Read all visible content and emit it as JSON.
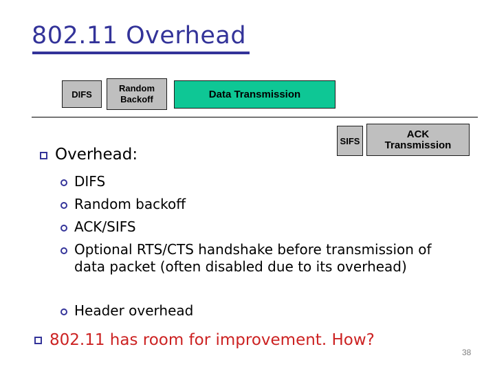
{
  "slide": {
    "title": "802.11 Overhead",
    "title_color": "#333399",
    "page_number": "38",
    "background": "#ffffff"
  },
  "timeline_diagram": {
    "name": "802.11 frame exchange timeline",
    "rule_color": "#000000",
    "boxes": [
      {
        "id": "difs",
        "label": "DIFS",
        "row": 1,
        "fill": "#bfbfbf",
        "text_color": "#000000"
      },
      {
        "id": "backoff",
        "line1": "Random",
        "line2": "Backoff",
        "row": 1,
        "fill": "#bfbfbf",
        "text_color": "#000000"
      },
      {
        "id": "data",
        "label": "Data Transmission",
        "row": 1,
        "fill": "#0ec795",
        "text_color": "#000000"
      },
      {
        "id": "sifs",
        "label": "SIFS",
        "row": 2,
        "fill": "#bfbfbf",
        "text_color": "#000000"
      },
      {
        "id": "ack",
        "line1": "ACK",
        "line2": "Transmission",
        "row": 2,
        "fill": "#bfbfbf",
        "text_color": "#000000"
      }
    ]
  },
  "body": {
    "overhead_heading": "Overhead:",
    "overhead_items": [
      "DIFS",
      "Random backoff",
      "ACK/SIFS",
      "Optional RTS/CTS handshake before transmission of data packet (often disabled due to its overhead)",
      "Header overhead"
    ],
    "closing_statement": "802.11 has room for improvement. How?",
    "closing_color": "#cc2222",
    "bullet_marker_color": "#333399"
  }
}
